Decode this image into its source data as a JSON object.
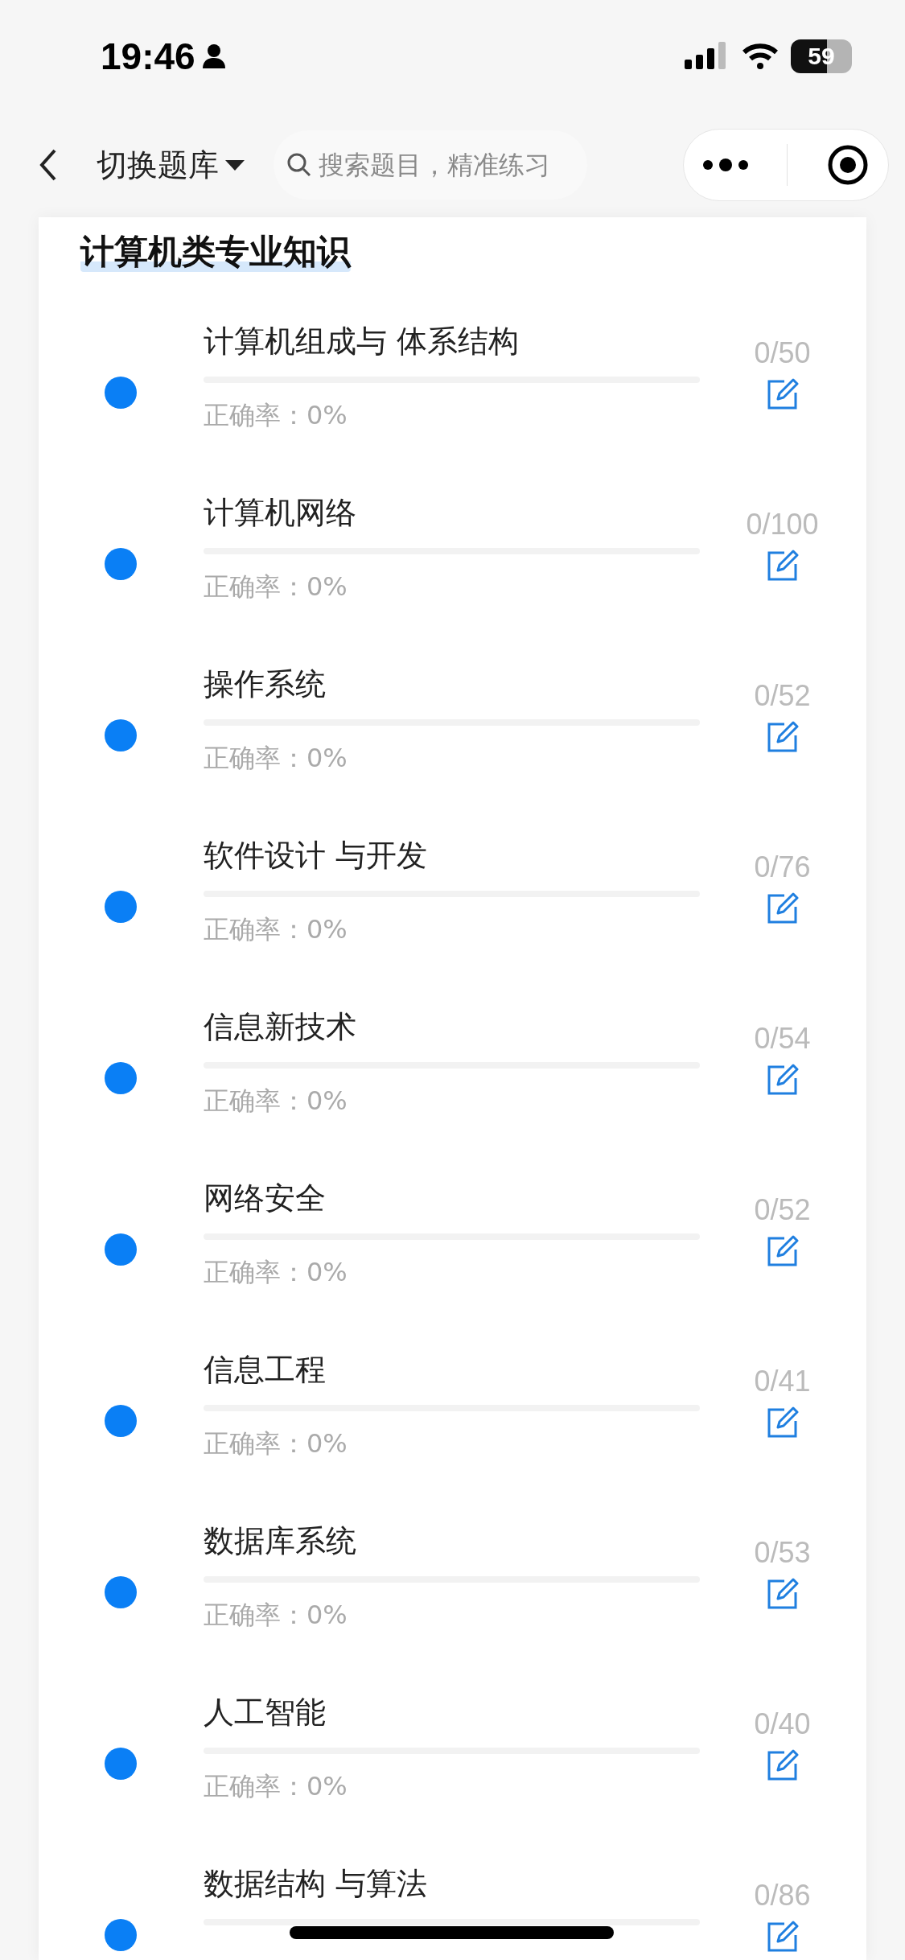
{
  "status_bar": {
    "time": "19:46",
    "battery": "59"
  },
  "nav": {
    "title": "切换题库",
    "expanded": false,
    "search": {
      "placeholder": "搜索题目，精准练习"
    }
  },
  "section": {
    "title": "计算机类专业知识",
    "items": [
      {
        "title": "计算机组成与 体系结构",
        "level": 0,
        "accuracy": "正确率：0%",
        "count": "0/50"
      },
      {
        "title": "计算机网络",
        "level": 0,
        "accuracy": "正确率：0%",
        "count": "0/100"
      },
      {
        "title": "操作系统",
        "level": 0,
        "accuracy": "正确率：0%",
        "count": "0/52"
      },
      {
        "title": "软件设计 与开发",
        "level": 0,
        "accuracy": "正确率：0%",
        "count": "0/76"
      },
      {
        "title": "信息新技术",
        "level": 0,
        "accuracy": "正确率：0%",
        "count": "0/54"
      },
      {
        "title": "网络安全",
        "level": 0,
        "accuracy": "正确率：0%",
        "count": "0/52"
      },
      {
        "title": "信息工程",
        "level": 0,
        "accuracy": "正确率：0%",
        "count": "0/41"
      },
      {
        "title": "数据库系统",
        "level": 0,
        "accuracy": "正确率：0%",
        "count": "0/53"
      },
      {
        "title": "人工智能",
        "level": 0,
        "accuracy": "正确率：0%",
        "count": "0/40"
      },
      {
        "title": "数据结构 与算法",
        "level": 0,
        "count": "0/86"
      }
    ]
  }
}
